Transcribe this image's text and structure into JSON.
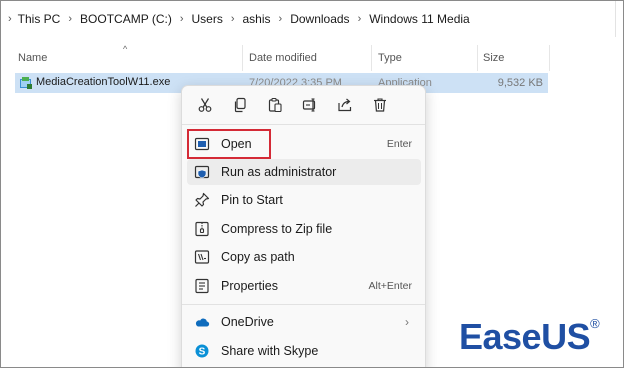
{
  "breadcrumb": [
    "This PC",
    "BOOTCAMP (C:)",
    "Users",
    "ashis",
    "Downloads",
    "Windows 11 Media"
  ],
  "columns": {
    "name": "Name",
    "date_modified": "Date modified",
    "type": "Type",
    "size": "Size"
  },
  "file": {
    "name": "MediaCreationToolW11.exe",
    "date": "7/20/2022 3:35 PM",
    "type": "Application",
    "size": "9,532 KB"
  },
  "toolbar_icons": [
    "cut-icon",
    "copy-icon",
    "paste-icon",
    "rename-icon",
    "share-icon",
    "delete-icon"
  ],
  "menu": {
    "open": {
      "label": "Open",
      "shortcut": "Enter"
    },
    "run_admin": {
      "label": "Run as administrator"
    },
    "pin_start": {
      "label": "Pin to Start"
    },
    "compress": {
      "label": "Compress to Zip file"
    },
    "copy_path": {
      "label": "Copy as path"
    },
    "properties": {
      "label": "Properties",
      "shortcut": "Alt+Enter"
    },
    "onedrive": {
      "label": "OneDrive",
      "arrow": "›"
    },
    "skype": {
      "label": "Share with Skype"
    }
  },
  "logo": {
    "ease": "Ease",
    "us": "US",
    "reg": "®"
  },
  "colors": {
    "selection": "#cde1f5",
    "highlight_box": "#d42a36",
    "logo_blue": "#1f4fa3",
    "onedrive_blue": "#0f6cbd",
    "skype_blue": "#0a90d6"
  }
}
